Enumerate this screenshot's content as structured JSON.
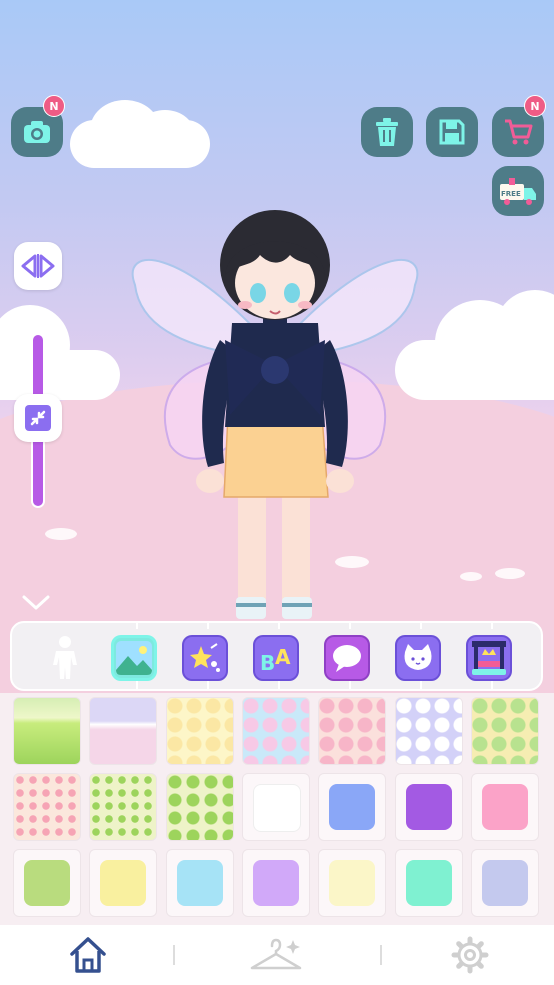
{
  "top_buttons": {
    "camera": {
      "icon": "camera-icon",
      "badge": "N"
    },
    "trash": {
      "icon": "trash-icon"
    },
    "save": {
      "icon": "save-icon"
    },
    "shop": {
      "icon": "cart-icon",
      "badge": "N"
    },
    "free_delivery": {
      "icon": "free-delivery-truck-icon",
      "label": "FREE"
    }
  },
  "side_buttons": {
    "flip": "flip-horizontal-icon",
    "zoom": "shrink-icon",
    "collapse": "chevron-down-icon"
  },
  "categories": [
    {
      "name": "body",
      "icon": "person-icon",
      "selected": false
    },
    {
      "name": "background",
      "icon": "landscape-icon",
      "selected": true
    },
    {
      "name": "effects",
      "icon": "star-sparkle-icon",
      "selected": false
    },
    {
      "name": "text",
      "icon": "letters-icon",
      "label": "BA",
      "selected": false
    },
    {
      "name": "speech",
      "icon": "speech-bubble-icon",
      "selected": false
    },
    {
      "name": "pet",
      "icon": "cat-icon",
      "selected": false
    },
    {
      "name": "stage",
      "icon": "stage-crown-icon",
      "selected": false
    }
  ],
  "items": [
    {
      "kind": "landscape",
      "colors": [
        "#c8ec7d",
        "#9dd45c"
      ]
    },
    {
      "kind": "pink-ground",
      "colors": [
        "#dcd7f6",
        "#f5d6e8"
      ]
    },
    {
      "kind": "polka",
      "colors": [
        "#fdf6c8",
        "#fbe7a4"
      ]
    },
    {
      "kind": "polka",
      "colors": [
        "#c9e9f9",
        "#f7c9e6"
      ]
    },
    {
      "kind": "polka",
      "colors": [
        "#fbe0dc",
        "#f7b5c8"
      ]
    },
    {
      "kind": "polka",
      "colors": [
        "#d3d1f8",
        "#ffffff"
      ]
    },
    {
      "kind": "polka",
      "colors": [
        "#f6edb2",
        "#b8e28f"
      ]
    },
    {
      "kind": "hearts",
      "colors": [
        "#fbe7dc",
        "#f6a4b5"
      ]
    },
    {
      "kind": "hearts",
      "colors": [
        "#eef3c8",
        "#9dd45c"
      ]
    },
    {
      "kind": "stars",
      "colors": [
        "#eef3c8",
        "#9dd45c"
      ]
    },
    {
      "kind": "solid",
      "colors": [
        "#ffffff"
      ]
    },
    {
      "kind": "solid",
      "colors": [
        "#8aa7f7"
      ]
    },
    {
      "kind": "solid",
      "colors": [
        "#a35ae3"
      ]
    },
    {
      "kind": "solid",
      "colors": [
        "#fba3c8"
      ]
    },
    {
      "kind": "solid",
      "colors": [
        "#b9dc7e"
      ]
    },
    {
      "kind": "solid",
      "colors": [
        "#f9f09f"
      ]
    },
    {
      "kind": "solid",
      "colors": [
        "#a6e3f6"
      ]
    },
    {
      "kind": "solid",
      "colors": [
        "#d1a9f9"
      ]
    },
    {
      "kind": "solid",
      "colors": [
        "#fbf6c8"
      ]
    },
    {
      "kind": "solid",
      "colors": [
        "#7ff1d1"
      ]
    },
    {
      "kind": "solid",
      "colors": [
        "#c4c9ee"
      ]
    }
  ],
  "bottom_nav": [
    {
      "name": "home",
      "icon": "home-icon",
      "active": true
    },
    {
      "name": "wardrobe",
      "icon": "hanger-icon",
      "active": false
    },
    {
      "name": "settings",
      "icon": "gear-icon",
      "active": false
    }
  ],
  "colors": {
    "button_teal": "#4e7c88",
    "badge_pink": "#ef5c85",
    "slider_purple": "#b75ae6",
    "accent_purple": "#8b6ef0",
    "nav_active": "#35508f"
  }
}
